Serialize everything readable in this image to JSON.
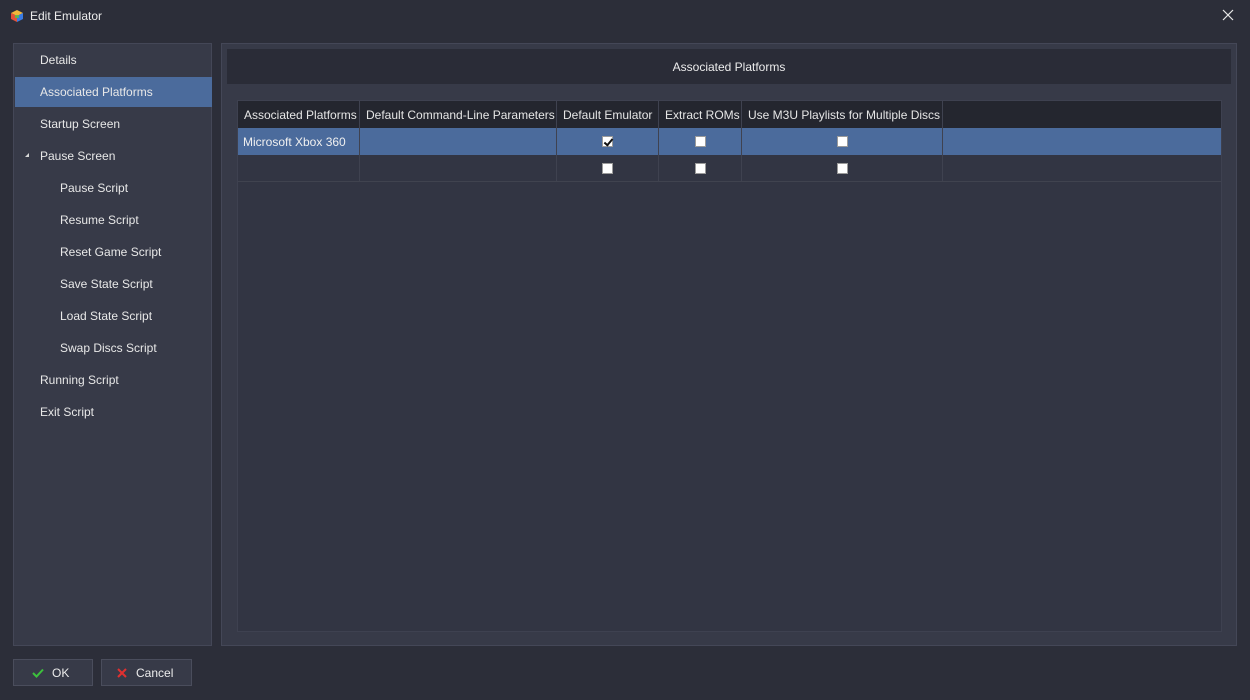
{
  "window": {
    "title": "Edit Emulator"
  },
  "sidebar": {
    "items": [
      {
        "label": "Details",
        "level": 0,
        "selected": false
      },
      {
        "label": "Associated Platforms",
        "level": 0,
        "selected": true
      },
      {
        "label": "Startup Screen",
        "level": 0,
        "selected": false
      },
      {
        "label": "Pause Screen",
        "level": 0,
        "selected": false,
        "expanded": true
      },
      {
        "label": "Pause Script",
        "level": 1,
        "selected": false
      },
      {
        "label": "Resume Script",
        "level": 1,
        "selected": false
      },
      {
        "label": "Reset Game Script",
        "level": 1,
        "selected": false
      },
      {
        "label": "Save State Script",
        "level": 1,
        "selected": false
      },
      {
        "label": "Load State Script",
        "level": 1,
        "selected": false
      },
      {
        "label": "Swap Discs Script",
        "level": 1,
        "selected": false
      },
      {
        "label": "Running Script",
        "level": 0,
        "selected": false
      },
      {
        "label": "Exit Script",
        "level": 0,
        "selected": false
      }
    ]
  },
  "main": {
    "header": "Associated Platforms",
    "table": {
      "columns": [
        "Associated Platforms",
        "Default Command-Line Parameters",
        "Default Emulator",
        "Extract ROMs",
        "Use M3U Playlists for Multiple Discs"
      ],
      "rows": [
        {
          "platform": "Microsoft Xbox 360",
          "params": "",
          "default_emulator": true,
          "extract_roms": false,
          "use_m3u": false,
          "selected": true
        },
        {
          "platform": "",
          "params": "",
          "default_emulator": false,
          "extract_roms": false,
          "use_m3u": false,
          "selected": false
        }
      ]
    }
  },
  "buttons": {
    "ok_label": "OK",
    "cancel_label": "Cancel"
  },
  "colors": {
    "selection": "#4b6b9c",
    "ok_icon": "#3cc13c",
    "cancel_icon": "#e03030"
  },
  "icons": {
    "app": "launchbox-cube-icon",
    "close": "close-icon",
    "ok": "checkmark-icon",
    "cancel": "x-icon"
  }
}
